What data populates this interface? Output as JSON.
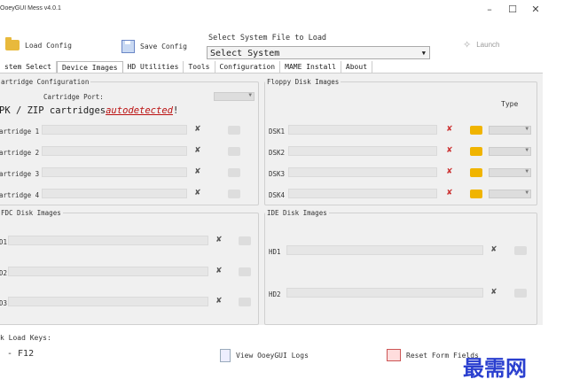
{
  "window": {
    "title": "OoeyGUI Mess v4.0.1"
  },
  "toolbar": {
    "load_config": "Load Config",
    "save_config": "Save Config",
    "select_label": "Select System File to Load",
    "select_value": "Select System",
    "launch": "Launch"
  },
  "tabs": [
    "stem Select",
    "Device Images",
    "HD Utilities",
    "Tools",
    "Configuration",
    "MAME Install",
    "About"
  ],
  "cartridge": {
    "title": "artridge Configuration",
    "port_label": "Cartridge Port:",
    "auto_prefix": "PK / ZIP cartridges",
    "auto_word": "autodetected",
    "auto_suffix": "!",
    "rows": [
      "artridge 1",
      "artridge 2",
      "artridge 3",
      "artridge 4"
    ]
  },
  "floppy": {
    "title": "Floppy Disk Images",
    "type_label": "Type",
    "rows": [
      "DSK1",
      "DSK2",
      "DSK3",
      "DSK4"
    ]
  },
  "fdc": {
    "title": "FDC Disk Images",
    "rows": [
      "D1",
      "D2",
      "D3"
    ]
  },
  "ide": {
    "title": "IDE Disk Images",
    "rows": [
      "HD1",
      "HD2"
    ]
  },
  "bottom": {
    "keys_label": "k Load Keys:",
    "key_value": "- F12",
    "view_logs": "View OoeyGUI Logs",
    "reset": "Reset Form Fields"
  },
  "watermark": "最需网"
}
